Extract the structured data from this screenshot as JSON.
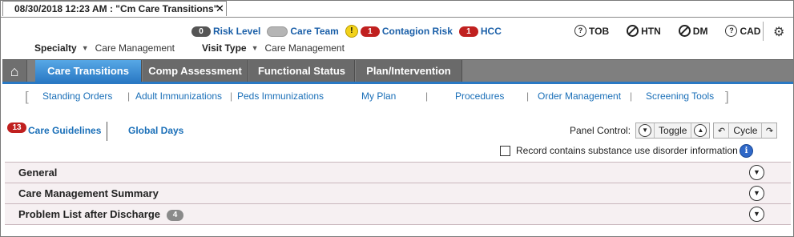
{
  "tab": {
    "title": "08/30/2018 12:23 AM : \"Cm Care Transitions\"",
    "close": "✕"
  },
  "header": {
    "indicators": [
      {
        "count": "0",
        "label": "Risk Level"
      },
      {
        "count": "",
        "label": "Care Team"
      },
      {
        "count": "1",
        "label": "Contagion Risk",
        "warn": "!"
      },
      {
        "count": "1",
        "label": "HCC"
      }
    ],
    "risk_flags": [
      {
        "state": "?",
        "label": "TOB"
      },
      {
        "state": "no",
        "label": "HTN"
      },
      {
        "state": "no",
        "label": "DM"
      },
      {
        "state": "?",
        "label": "CAD"
      }
    ],
    "specialty_label": "Specialty",
    "specialty_value": "Care Management",
    "visit_type_label": "Visit Type",
    "visit_type_value": "Care Management"
  },
  "nav": {
    "tabs": [
      "Care Transitions",
      "Comp Assessment",
      "Functional Status",
      "Plan/Intervention"
    ],
    "active": "Care Transitions"
  },
  "subnav": [
    "Standing Orders",
    "Adult Immunizations",
    "Peds Immunizations",
    "My Plan",
    "Procedures",
    "Order Management",
    "Screening Tools"
  ],
  "guidelines": {
    "badge": "13",
    "care_guidelines": "Care Guidelines",
    "global_days": "Global Days"
  },
  "panel_control": {
    "label": "Panel Control:",
    "toggle": "Toggle",
    "cycle": "Cycle"
  },
  "substance": {
    "label": "Record contains substance use disorder information",
    "checked": false
  },
  "panels": [
    {
      "title": "General",
      "count": ""
    },
    {
      "title": "Care Management Summary",
      "count": ""
    },
    {
      "title": "Problem List after Discharge",
      "count": "4"
    }
  ],
  "colors": {
    "accent_blue": "#2a79c4",
    "link_blue": "#1a6fb8",
    "badge_red": "#c0201f",
    "nav_grey": "#7f7f7f"
  }
}
